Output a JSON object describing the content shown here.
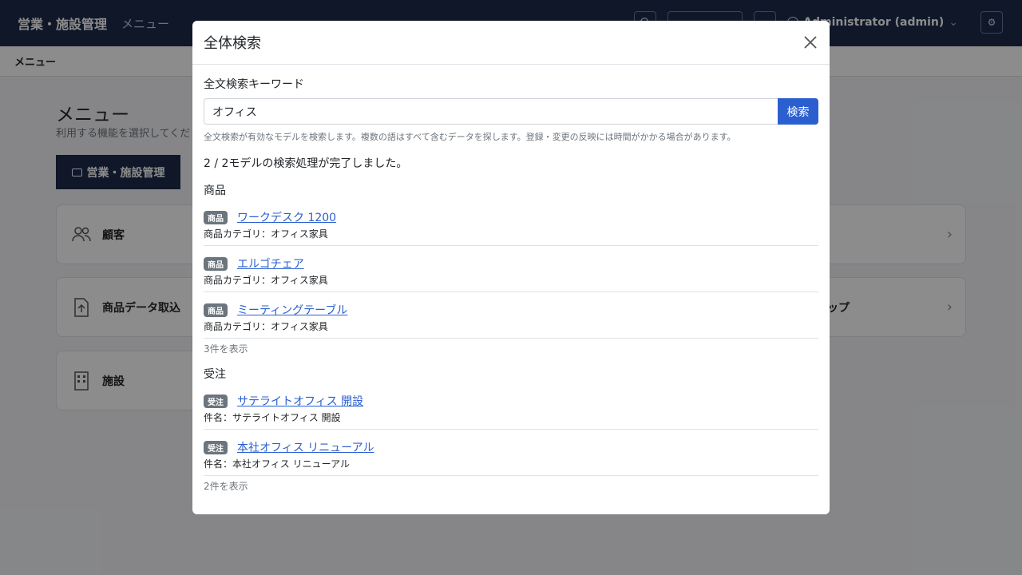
{
  "app": {
    "brand": "営業・施設管理",
    "nav_menu": "メニュー",
    "user": "Administrator (admin)",
    "breadcrumb": "メニュー"
  },
  "page": {
    "title": "メニュー",
    "subtitle": "利用する機能を選択してくだ",
    "active_tab": "営業・施設管理",
    "cards": [
      {
        "label": "顧客",
        "icon": "users-icon"
      },
      {
        "label": "商品データ取込",
        "icon": "file-upload-icon",
        "right_label": "ップ"
      },
      {
        "label": "施設",
        "icon": "building-icon"
      }
    ]
  },
  "modal": {
    "title": "全体検索",
    "keyword_label": "全文検索キーワード",
    "keyword_value": "オフィス",
    "search_button": "検索",
    "help": "全文検索が有効なモデルを検索します。複数の語はすべて含むデータを探します。登録・変更の反映には時間がかかる場合があります。",
    "status": "2 / 2モデルの検索処理が完了しました。",
    "sections": [
      {
        "title": "商品",
        "results": [
          {
            "badge": "商品",
            "link": "ワークデスク 1200",
            "desc": "商品カテゴリ：オフィス家具"
          },
          {
            "badge": "商品",
            "link": "エルゴチェア",
            "desc": "商品カテゴリ：オフィス家具"
          },
          {
            "badge": "商品",
            "link": "ミーティングテーブル",
            "desc": "商品カテゴリ：オフィス家具"
          }
        ],
        "count": "3件を表示"
      },
      {
        "title": "受注",
        "results": [
          {
            "badge": "受注",
            "link": "サテライトオフィス 開設",
            "desc": "件名：サテライトオフィス 開設"
          },
          {
            "badge": "受注",
            "link": "本社オフィス リニューアル",
            "desc": "件名：本社オフィス リニューアル"
          }
        ],
        "count": "2件を表示"
      }
    ]
  }
}
